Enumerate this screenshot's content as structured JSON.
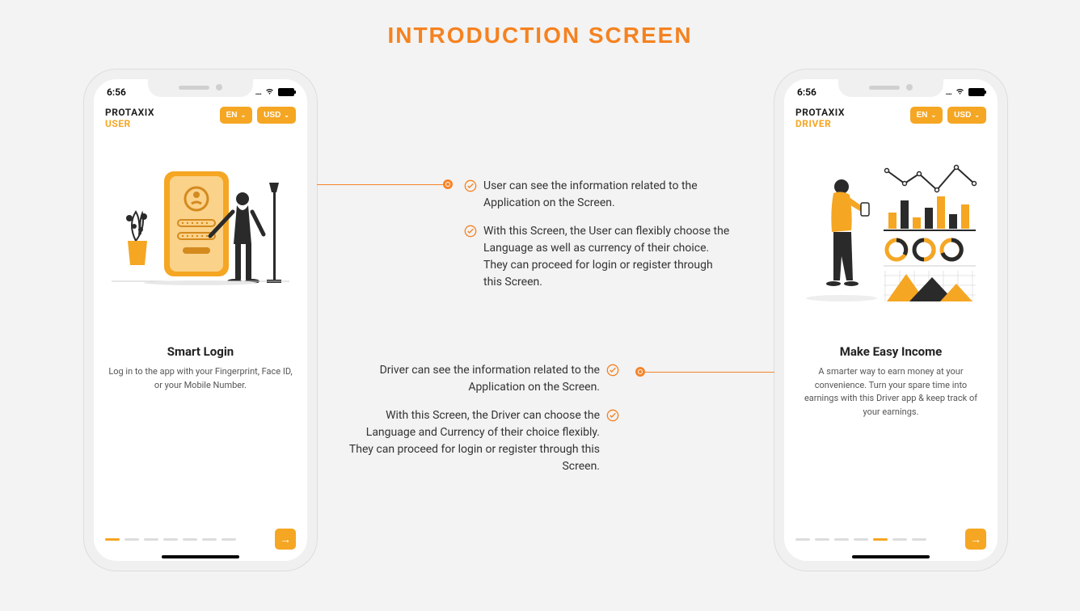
{
  "page_title": "INTRODUCTION SCREEN",
  "status_time": "6:56",
  "brand_name": "PROTAXIX",
  "lang_label": "EN",
  "currency_label": "USD",
  "user_phone": {
    "role": "USER",
    "title": "Smart Login",
    "desc": "Log in to the app with your Fingerprint, Face ID, or your Mobile Number.",
    "active_dot": 0,
    "total_dots": 7
  },
  "driver_phone": {
    "role": "DRIVER",
    "title": "Make Easy Income",
    "desc": "A smarter way to earn money at your convenience. Turn your spare time into earnings with this Driver app & keep track of your earnings.",
    "active_dot": 4,
    "total_dots": 7
  },
  "user_info": [
    "User can see the information related to the Application on the Screen.",
    "With this Screen, the User can flexibly choose the Language as well as currency of their choice. They can proceed for login or register through this Screen."
  ],
  "driver_info": [
    "Driver can see the information related to the Application on the Screen.",
    "With this Screen, the Driver can choose the Language and Currency of their choice flexibly. They can proceed for login or register through this Screen."
  ]
}
